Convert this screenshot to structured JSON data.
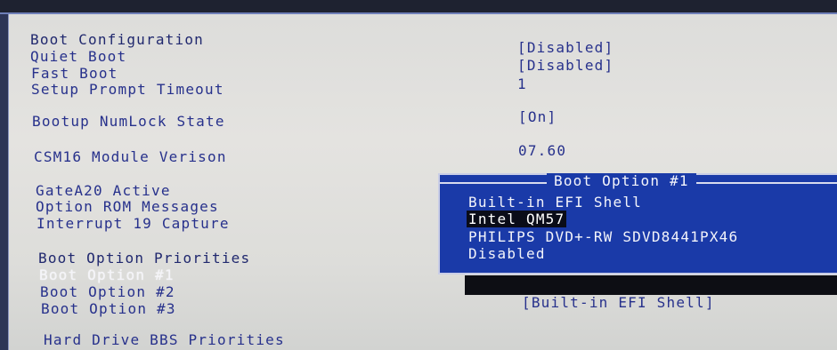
{
  "settings": {
    "boot_configuration": "Boot Configuration",
    "quiet_boot": {
      "label": "Quiet Boot",
      "value": "[Disabled]"
    },
    "fast_boot": {
      "label": "Fast Boot",
      "value": "[Disabled]"
    },
    "setup_prompt_timeout": {
      "label": "Setup Prompt Timeout",
      "value": "1"
    },
    "bootup_numlock_state": {
      "label": "Bootup NumLock State",
      "value": "[On]"
    },
    "csm16_module_version": {
      "label": "CSM16 Module Verison",
      "value": "07.60"
    },
    "gatea20_active": {
      "label": "GateA20 Active"
    },
    "option_rom_messages": {
      "label": "Option ROM Messages"
    },
    "interrupt19_capture": {
      "label": "Interrupt 19 Capture"
    },
    "boot_option_priorities": "Boot Option Priorities",
    "boot_option_1": {
      "label": "Boot Option #1"
    },
    "boot_option_2": {
      "label": "Boot Option #2"
    },
    "boot_option_3": {
      "label": "Boot Option #3",
      "value": "[Built-in EFI Shell]"
    },
    "hard_drive_bbs_priorities": "Hard Drive BBS Priorities"
  },
  "popup": {
    "title": "Boot Option #1",
    "options": [
      "Built-in EFI Shell",
      "Intel QM57",
      "PHILIPS DVD+-RW SDVD8441PX46",
      "Disabled"
    ],
    "highlighted_index": 1
  },
  "colors": {
    "background": "#dcdcda",
    "text": "#27318c",
    "selected_text": "#f4f4f8",
    "popup_bg": "#1a3aa8",
    "popup_text": "#f1f2f8"
  }
}
